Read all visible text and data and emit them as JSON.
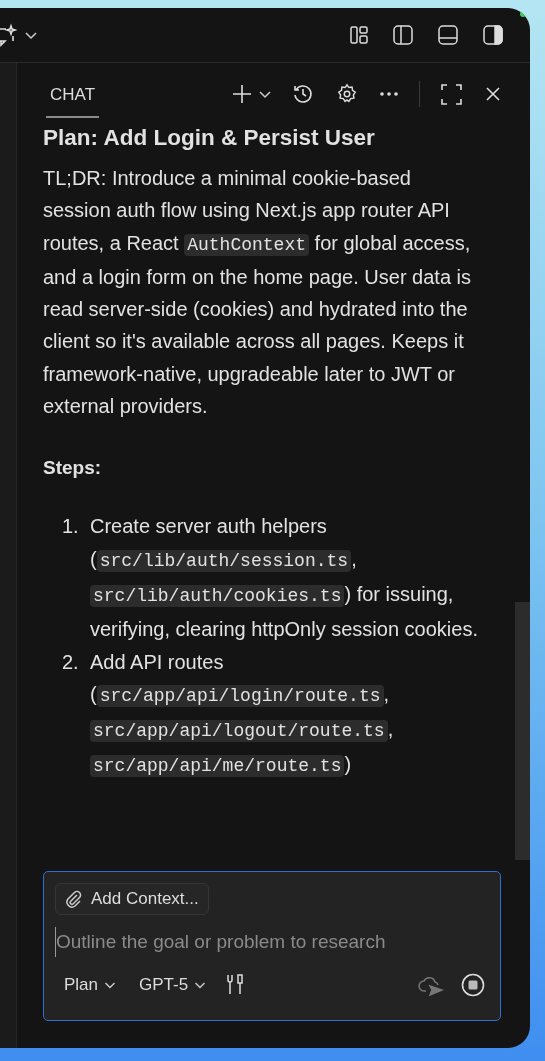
{
  "panel": {
    "tab": {
      "label": "CHAT",
      "selected": true
    }
  },
  "plan": {
    "title": "Plan: Add Login & Persist User",
    "summary": [
      {
        "kind": "text",
        "text": "TL;DR: Introduce a minimal cookie-based session auth flow using Next.js app router API routes, a React "
      },
      {
        "kind": "code",
        "text": "AuthContext"
      },
      {
        "kind": "text",
        "text": " for global access, and a login form on the home page. User data is read server-side (cookies) and hydrated into the client so it's available across all pages. Keeps it framework-native, upgradeable later to JWT or external providers."
      }
    ],
    "steps_heading": "Steps:",
    "steps": [
      {
        "number": "1.",
        "parts": [
          {
            "kind": "text",
            "text": "Create server auth helpers ("
          },
          {
            "kind": "code",
            "text": "src/lib/auth/session.ts"
          },
          {
            "kind": "text",
            "text": ", "
          },
          {
            "kind": "code",
            "text": "src/lib/auth/cookies.ts"
          },
          {
            "kind": "text",
            "text": ") for issuing, verifying, clearing httpOnly session cookies."
          }
        ]
      },
      {
        "number": "2.",
        "parts": [
          {
            "kind": "text",
            "text": "Add API routes ("
          },
          {
            "kind": "code",
            "text": "src/app/api/login/route.ts"
          },
          {
            "kind": "text",
            "text": ", "
          },
          {
            "kind": "code",
            "text": "src/app/api/logout/route.ts"
          },
          {
            "kind": "text",
            "text": ", "
          },
          {
            "kind": "code",
            "text": "src/app/api/me/route.ts"
          },
          {
            "kind": "text",
            "text": ")"
          }
        ]
      }
    ]
  },
  "composer": {
    "context_button": "Add Context...",
    "placeholder": "Outline the goal or problem to research",
    "mode": "Plan",
    "model": "GPT-5"
  }
}
